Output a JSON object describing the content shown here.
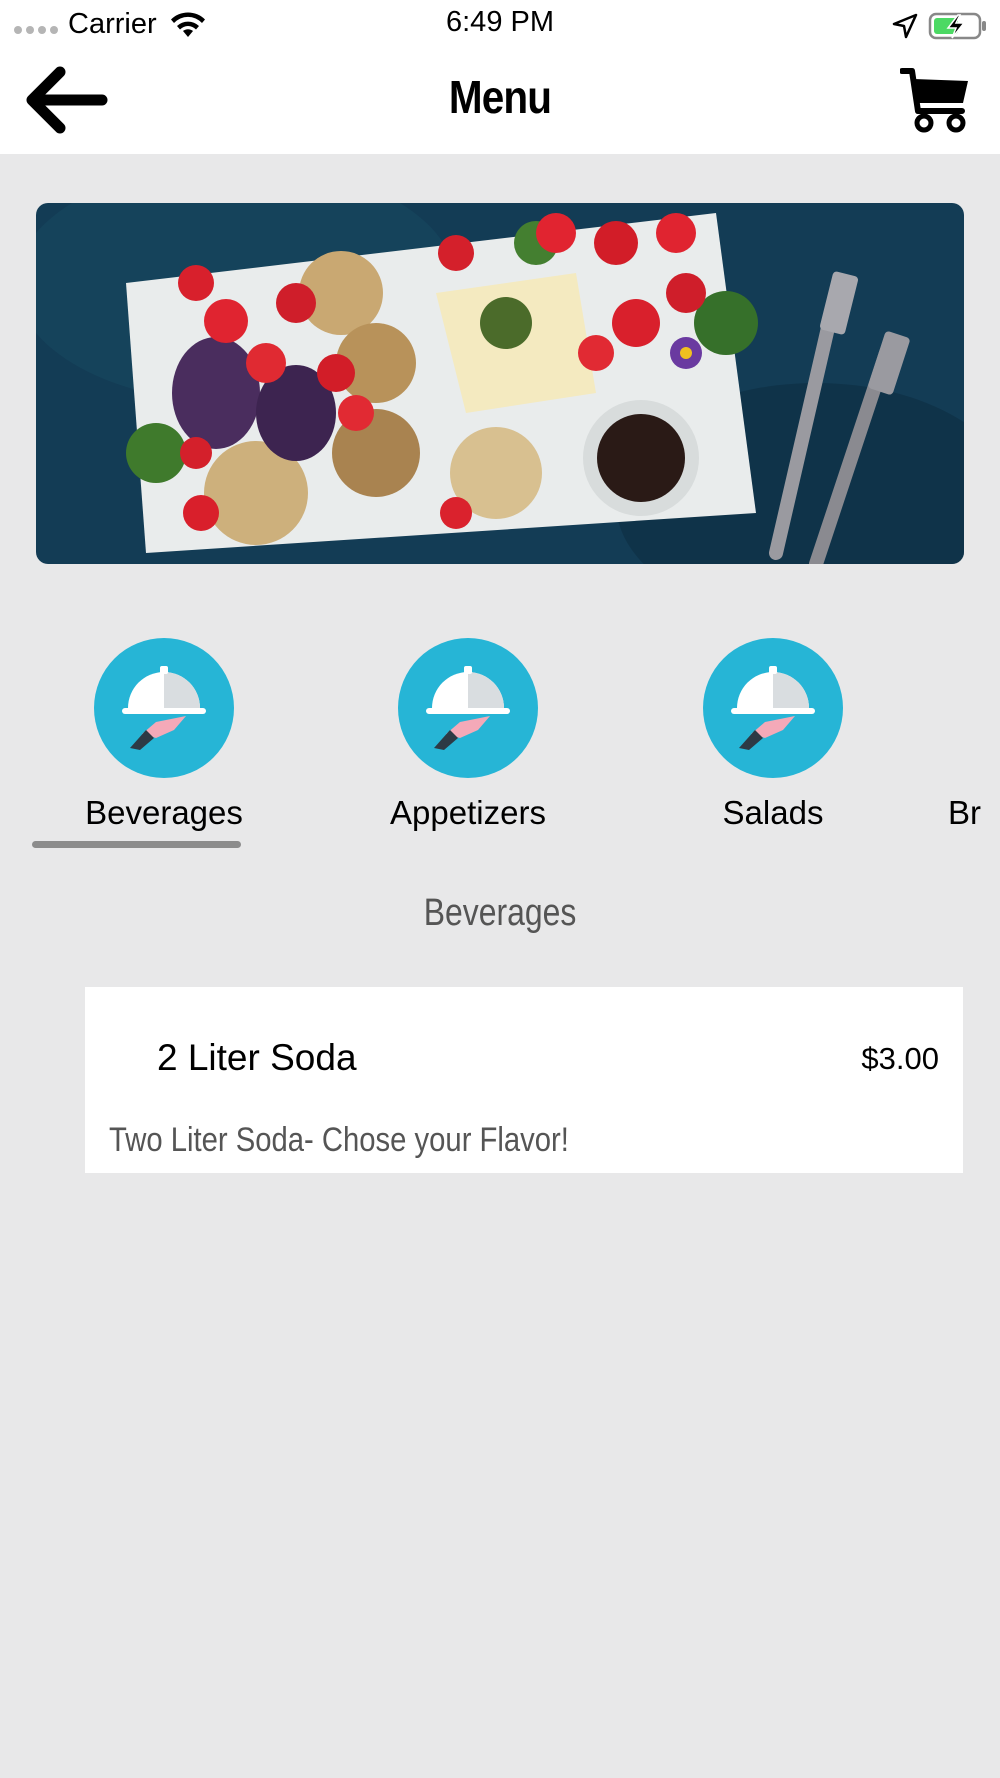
{
  "status_bar": {
    "carrier": "Carrier",
    "time": "6:49 PM",
    "icons": [
      "signal-dots-icon",
      "wifi-icon",
      "location-arrow-icon",
      "battery-charging-icon"
    ]
  },
  "nav": {
    "title": "Menu",
    "back_icon": "arrow-left-icon",
    "cart_icon": "shopping-cart-icon"
  },
  "hero": {
    "description": "food platter banner image",
    "background_color": "#123a52"
  },
  "categories": [
    {
      "label": "Beverages",
      "icon": "serving-cloche-icon",
      "selected": true
    },
    {
      "label": "Appetizers",
      "icon": "serving-cloche-icon",
      "selected": false
    },
    {
      "label": "Salads",
      "icon": "serving-cloche-icon",
      "selected": false
    },
    {
      "label": "Br",
      "icon": "serving-cloche-icon",
      "selected": false
    }
  ],
  "section": {
    "title": "Beverages"
  },
  "items": [
    {
      "name": "2 Liter Soda",
      "price": "$3.00",
      "description": "Two Liter Soda- Chose your Flavor!"
    }
  ],
  "colors": {
    "accent": "#26b5d6",
    "background": "#e8e8e9",
    "card": "#ffffff",
    "underline": "#8c8c8c"
  }
}
